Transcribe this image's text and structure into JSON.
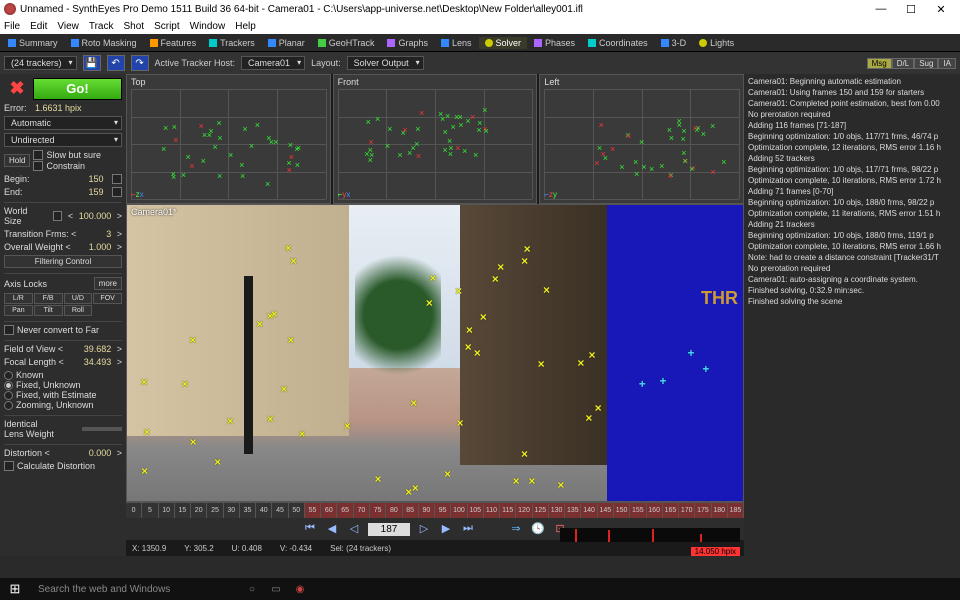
{
  "titlebar": {
    "title": "Unnamed - SynthEyes Pro Demo 1511 Build 36 64-bit - Camera01 - C:\\Users\\app-universe.net\\Desktop\\New Folder\\alley001.ifl"
  },
  "menubar": [
    "File",
    "Edit",
    "View",
    "Track",
    "Shot",
    "Script",
    "Window",
    "Help"
  ],
  "tabs": [
    {
      "label": "Summary"
    },
    {
      "label": "Roto Masking"
    },
    {
      "label": "Features"
    },
    {
      "label": "Trackers"
    },
    {
      "label": "Planar"
    },
    {
      "label": "GeoHTrack"
    },
    {
      "label": "Graphs"
    },
    {
      "label": "Lens"
    },
    {
      "label": "Solver",
      "active": true
    },
    {
      "label": "Phases"
    },
    {
      "label": "Coordinates"
    },
    {
      "label": "3-D"
    },
    {
      "label": "Lights"
    }
  ],
  "ctrlrow": {
    "trackers_dd": "(24 trackers)",
    "host_label": "Active Tracker Host:",
    "host_dd": "Camera01",
    "layout_label": "Layout:",
    "layout_dd": "Solver Output",
    "pills": [
      "Msg",
      "D/L",
      "Sug",
      "IA"
    ]
  },
  "leftpanel": {
    "go": "Go!",
    "error_label": "Error:",
    "error_value": "1.6631 hpix",
    "mode_dd": "Automatic",
    "dir_dd": "Undirected",
    "hold": "Hold",
    "slow": "Slow but sure",
    "constrain": "Constrain",
    "begin_label": "Begin:",
    "begin_val": "150",
    "end_label": "End:",
    "end_val": "159",
    "world_label": "World Size",
    "world_val": "100.000",
    "trans_label": "Transition Frms: <",
    "trans_val": "3",
    "weight_label": "Overall Weight <",
    "weight_val": "1.000",
    "filter_btn": "Filtering Control",
    "axis_label": "Axis Locks",
    "more": "more",
    "axis_btns": [
      "L/R",
      "F/B",
      "U/D",
      "FOV",
      "Pan",
      "Tilt",
      "Roll"
    ],
    "never_far": "Never convert to Far",
    "fov_label": "Field of View  <",
    "fov_val": "39.682",
    "focal_label": "Focal Length  <",
    "focal_val": "34.493",
    "radios": [
      "Known",
      "Fixed, Unknown",
      "Fixed, with Estimate",
      "Zooming, Unknown"
    ],
    "radio_sel": 1,
    "lens_label": "Identical\nLens Weight",
    "dist_label": "Distortion  <",
    "dist_val": "0.000",
    "calc_dist": "Calculate Distortion"
  },
  "views": {
    "top": "Top",
    "front": "Front",
    "left": "Left",
    "camera": "Camera01*"
  },
  "thr": "THR",
  "log": [
    "Camera01: Beginning automatic estimation",
    "Camera01: Using frames 150 and 159 for starters",
    "Camera01: Completed point estimation, best fom 0.00",
    "No prerotation required",
    "Adding 116 frames [71-187]",
    "Beginning optimization: 1/0 objs, 117/71 frms, 46/74 p",
    "Optimization complete, 12 iterations, RMS error 1.16 h",
    "Adding 52 trackers",
    "Beginning optimization: 1/0 objs, 117/71 frms, 98/22 p",
    "Optimization complete, 10 iterations, RMS error 1.72 h",
    "Adding 71 frames [0-70]",
    "Beginning optimization: 1/0 objs, 188/0 frms, 98/22 p",
    "Optimization complete, 11 iterations, RMS error 1.51 h",
    "Adding 21 trackers",
    "Beginning optimization: 1/0 objs, 188/0 frms, 119/1 p",
    "Optimization complete, 10 iterations, RMS error 1.66 h",
    "Note: had to create a distance constraint [Tracker31/T",
    "No prerotation required",
    "Camera01: auto-assigning a coordinate system.",
    "Finished solving, 0:32.9 min:sec.",
    "Finished solving the scene"
  ],
  "timeline": [
    0,
    5,
    10,
    15,
    20,
    25,
    30,
    35,
    40,
    45,
    50,
    55,
    60,
    65,
    70,
    75,
    80,
    85,
    90,
    95,
    100,
    105,
    110,
    115,
    120,
    125,
    130,
    135,
    140,
    145,
    150,
    155,
    160,
    165,
    170,
    175,
    180,
    185
  ],
  "timeline_red_start": 55,
  "playback": {
    "frame": "187"
  },
  "status": {
    "x_lbl": "X:",
    "x": "1350.9",
    "y_lbl": "Y:",
    "y": "305.2",
    "u_lbl": "U:",
    "u": "0.408",
    "v_lbl": "V:",
    "v": "-0.434",
    "sel_lbl": "Sel:",
    "sel": "(24 trackers)",
    "hpix": "14.050 hpix"
  },
  "taskbar": {
    "search": "Search the web and Windows"
  }
}
